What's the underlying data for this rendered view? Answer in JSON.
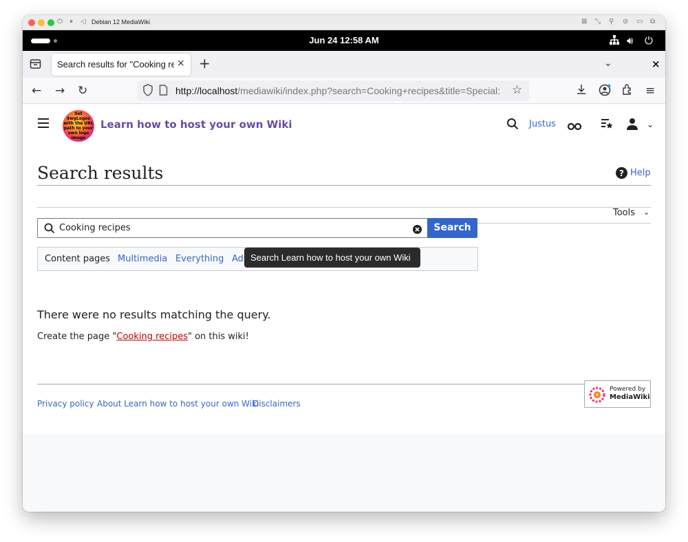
{
  "mac_window": {
    "title": "Debian 12 MediaWiki"
  },
  "gnome_bar": {
    "datetime": "Jun 24  12:58 AM"
  },
  "browser": {
    "tab_title": "Search results for \"Cooking rec",
    "url_host": "http://localhost",
    "url_path": "/mediawiki/index.php?search=Cooking+recipes&title=Special:"
  },
  "wiki": {
    "site_title": "Learn how to host your own Wiki",
    "logo_text": "Set $wgLogos with the URL path to your own logo image",
    "username": "Justus",
    "page_title": "Search results",
    "help_label": "Help",
    "tools_label": "Tools",
    "search": {
      "query": "Cooking recipes",
      "button_label": "Search"
    },
    "filters": [
      "Content pages",
      "Multimedia",
      "Everything",
      "Ad"
    ],
    "tooltip": "Search Learn how to host your own Wiki",
    "no_results": "There were no results matching the query.",
    "create_prefix": "Create the page \"",
    "create_link": "Cooking recipes",
    "create_suffix": "\" on this wiki!",
    "footer": [
      "Privacy policy",
      "About Learn how to host your own Wiki",
      "Disclaimers"
    ],
    "powered_by": {
      "line1": "Powered by",
      "line2": "MediaWiki"
    }
  },
  "colors": {
    "link": "#3366cc",
    "site_title": "#6b4ba1",
    "search_button": "#3366cc",
    "new_link": "#ba0000"
  }
}
